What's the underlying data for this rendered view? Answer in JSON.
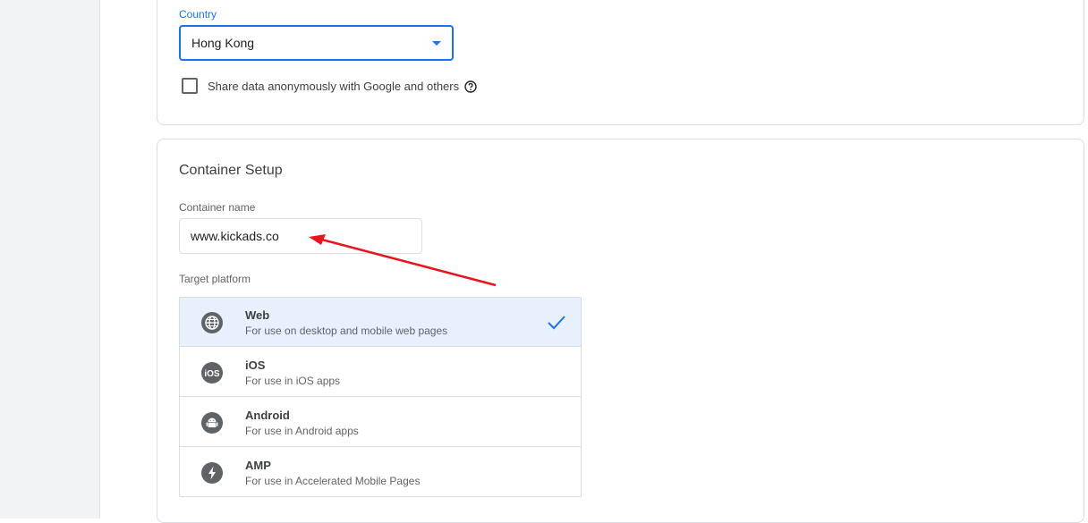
{
  "account": {
    "country_label": "Country",
    "country_value": "Hong Kong",
    "share_data_label": "Share data anonymously with Google and others"
  },
  "container": {
    "section_title": "Container Setup",
    "name_label": "Container name",
    "name_value": "www.kickads.co",
    "platform_label": "Target platform",
    "platforms": [
      {
        "name": "Web",
        "desc": "For use on desktop and mobile web pages",
        "icon": "globe-icon",
        "selected": true
      },
      {
        "name": "iOS",
        "desc": "For use in iOS apps",
        "icon": "ios-icon",
        "selected": false
      },
      {
        "name": "Android",
        "desc": "For use in Android apps",
        "icon": "android-icon",
        "selected": false
      },
      {
        "name": "AMP",
        "desc": "For use in Accelerated Mobile Pages",
        "icon": "lightning-icon",
        "selected": false
      }
    ]
  },
  "colors": {
    "accent": "#1a73e8",
    "selected_bg": "#e8f0fe",
    "annotation_arrow": "#e8141e"
  }
}
